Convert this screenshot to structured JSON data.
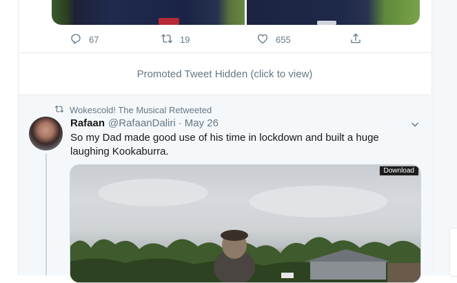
{
  "prev_tweet": {
    "reply_count": "67",
    "retweet_count": "19",
    "like_count": "655"
  },
  "promoted": {
    "label": "Promoted Tweet Hidden (click to view)"
  },
  "tweet": {
    "retweeted_by": "Wokescold! The Musical Retweeted",
    "display_name": "Rafaan",
    "handle": "@RafaanDaliri",
    "separator": "·",
    "date": "May 26",
    "text": "So my Dad made good use of his time in lockdown and built a huge laughing Kookaburra.",
    "media_button": "Download"
  },
  "icons": {
    "reply": "reply-icon",
    "retweet": "retweet-icon",
    "like": "like-icon",
    "share": "share-icon",
    "more": "chevron-down-icon"
  },
  "colors": {
    "accent": "#1da1f2",
    "muted": "#657786",
    "text": "#14171a",
    "border": "#e6ecf0",
    "highlight_bg": "#f5f8fa"
  }
}
